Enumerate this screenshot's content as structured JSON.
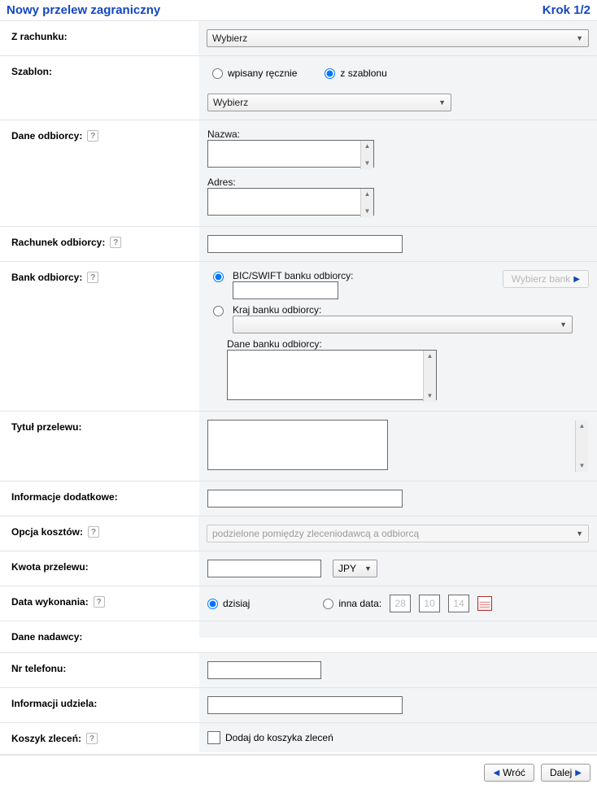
{
  "header": {
    "title": "Nowy przelew zagraniczny",
    "step": "Krok 1/2"
  },
  "from_account": {
    "label": "Z rachunku:",
    "select_text": "Wybierz"
  },
  "template": {
    "label": "Szablon:",
    "radio_manual": "wpisany ręcznie",
    "radio_from_template": "z szablonu",
    "selected": "z szablonu",
    "select_text": "Wybierz"
  },
  "recipient": {
    "label": "Dane odbiorcy:",
    "name_label": "Nazwa:",
    "address_label": "Adres:",
    "name_value": "",
    "address_value": ""
  },
  "recipient_account": {
    "label": "Rachunek odbiorcy:",
    "value": ""
  },
  "recipient_bank": {
    "label": "Bank odbiorcy:",
    "mode": "bic",
    "bic_label": "BIC/SWIFT banku odbiorcy:",
    "bic_value": "",
    "choose_bank_btn": "Wybierz bank",
    "country_label": "Kraj banku odbiorcy:",
    "country_select_text": "",
    "details_label": "Dane banku odbiorcy:",
    "details_value": ""
  },
  "title": {
    "label": "Tytuł przelewu:",
    "value": ""
  },
  "extra_info": {
    "label": "Informacje dodatkowe:",
    "value": ""
  },
  "cost_option": {
    "label": "Opcja kosztów:",
    "select_text": "podzielone pomiędzy zleceniodawcą a odbiorcą"
  },
  "amount": {
    "label": "Kwota przelewu:",
    "value": "",
    "currency": "JPY"
  },
  "date": {
    "label": "Data wykonania:",
    "radio_today": "dzisiaj",
    "radio_other": "inna data:",
    "selected": "today",
    "day": "28",
    "month": "10",
    "year": "14"
  },
  "sender": {
    "label": "Dane nadawcy:"
  },
  "phone": {
    "label": "Nr telefonu:",
    "value": ""
  },
  "contact": {
    "label": "Informacji udziela:",
    "value": ""
  },
  "basket": {
    "label": "Koszyk zleceń:",
    "checkbox_label": "Dodaj do koszyka zleceń",
    "checked": false
  },
  "footer": {
    "back": "Wróć",
    "next": "Dalej"
  }
}
